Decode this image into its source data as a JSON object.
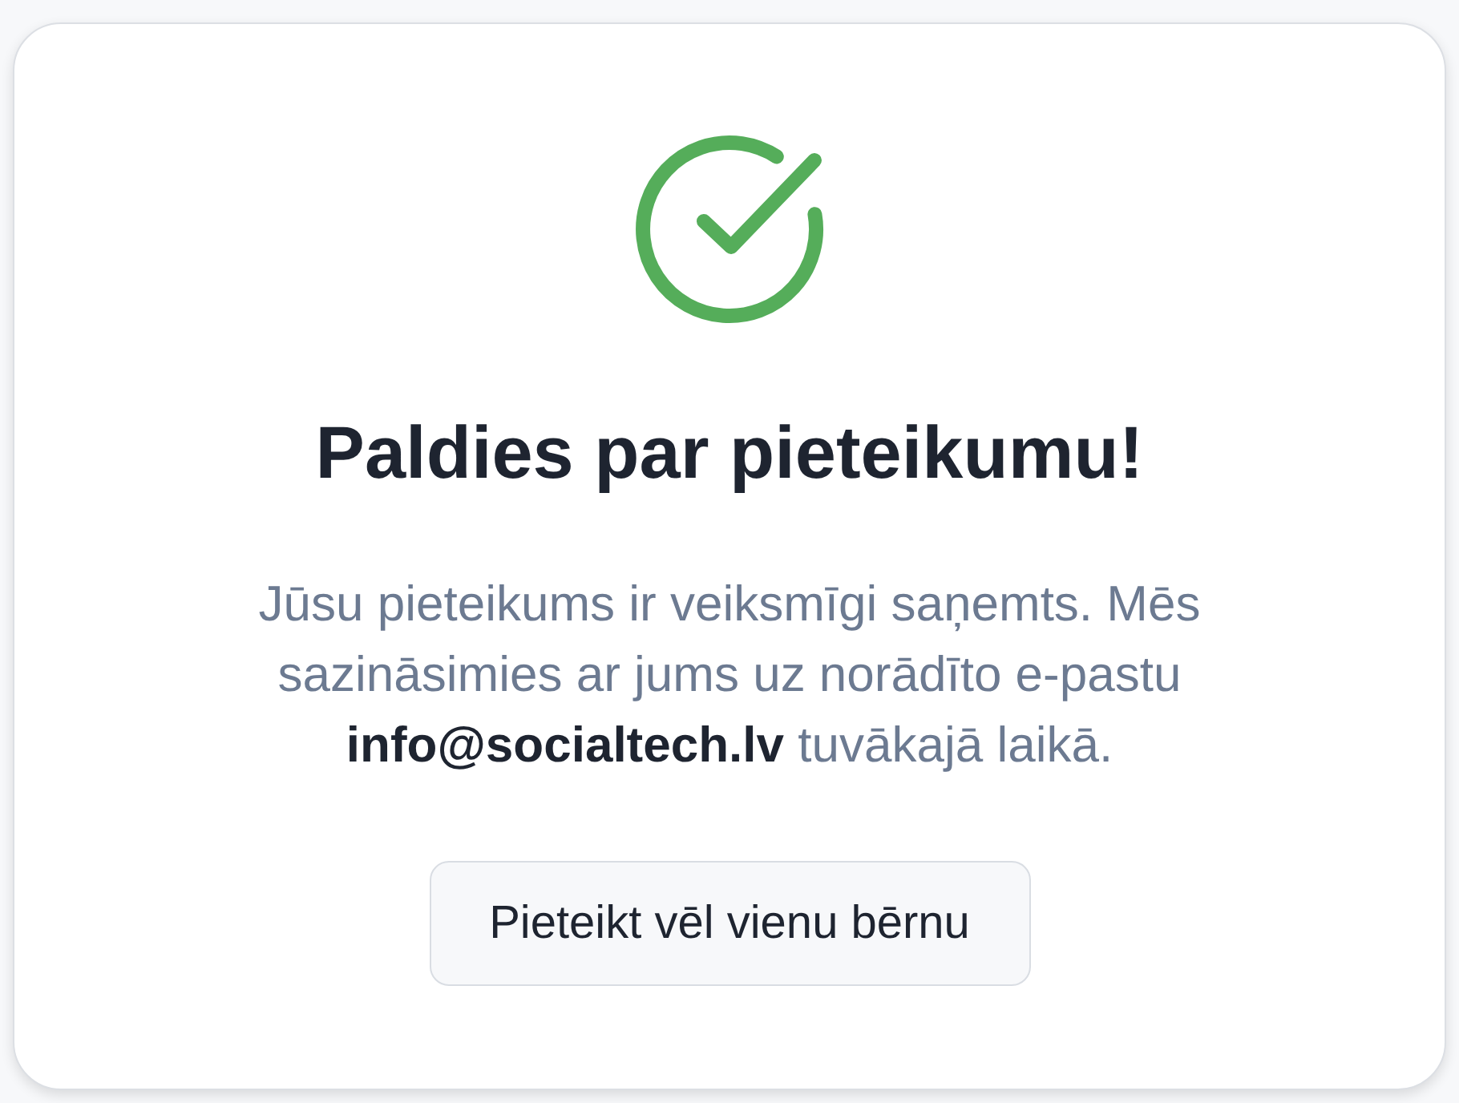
{
  "title": "Paldies par pieteikumu!",
  "message": "Jūsu pieteikums ir veiksmīgi saņemts. Mēs sazināsimies ar jums uz norādīto e-pastu **info@socialtech.lv** tuvākajā laikā.",
  "button": "Pieteikt vēl vienu bērnu"
}
